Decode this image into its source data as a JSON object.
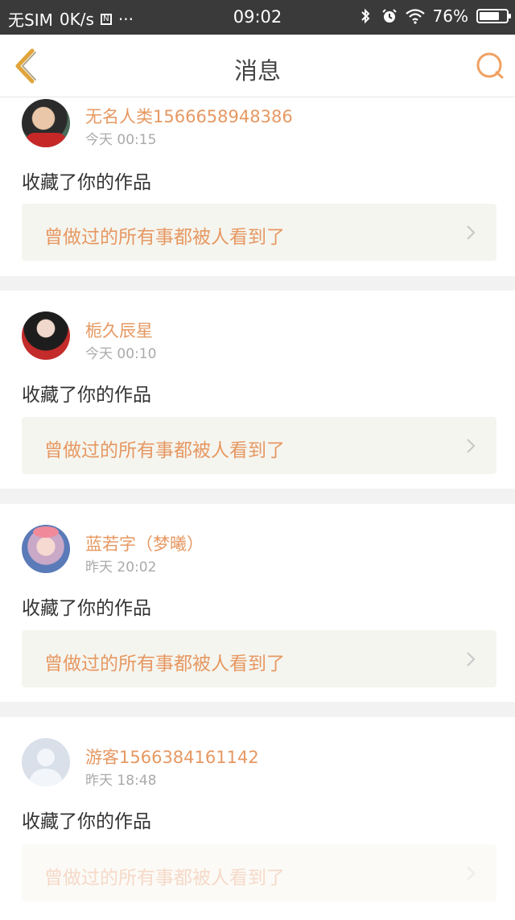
{
  "status_bar": {
    "carrier": "无SIM",
    "speed": "0K/s",
    "more": "···",
    "time": "09:02",
    "battery_text": "76%",
    "battery_level": 0.76
  },
  "nav": {
    "title": "消息",
    "accent": "#e0a43a"
  },
  "colors": {
    "username": "#e69862",
    "link_bg": "#f5f5ef"
  },
  "messages": [
    {
      "username": "无名人类1566658948386",
      "time": "今天 00:15",
      "action": "收藏了你的作品",
      "work_title": "曾做过的所有事都被人看到了",
      "avatar": "avatar-photo-1"
    },
    {
      "username": "栀久辰星",
      "time": "今天 00:10",
      "action": "收藏了你的作品",
      "work_title": "曾做过的所有事都被人看到了",
      "avatar": "avatar-photo-2"
    },
    {
      "username": "蓝若字（梦曦）",
      "time": "昨天 20:02",
      "action": "收藏了你的作品",
      "work_title": "曾做过的所有事都被人看到了",
      "avatar": "avatar-photo-3"
    },
    {
      "username": "游客1566384161142",
      "time": "昨天 18:48",
      "action": "收藏了你的作品",
      "work_title": "曾做过的所有事都被人看到了",
      "avatar": "default-avatar-icon"
    }
  ]
}
